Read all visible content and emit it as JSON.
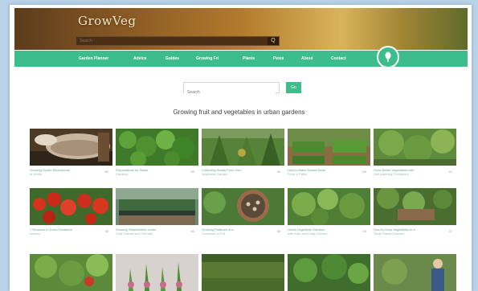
{
  "header": {
    "logo": "GrowVeg",
    "search_placeholder": "Search",
    "search_button": "Q"
  },
  "nav": {
    "items": [
      {
        "label": "Garden Planner"
      },
      {
        "label": "Advice"
      },
      {
        "label": "Guides"
      },
      {
        "label": "Growing Fri"
      },
      {
        "label": "Plants"
      },
      {
        "label": "Pests"
      },
      {
        "label": "About"
      },
      {
        "label": "Contact"
      }
    ]
  },
  "content": {
    "search_placeholder": "Search",
    "go_button": "Go",
    "title": "Growing fruit and vegetables in urban gardens"
  },
  "tiles": [
    {
      "caption": "Growing Oyster Mushrooms",
      "caption2": "at Home",
      "stat": "62"
    },
    {
      "caption": "Preparations for Salad",
      "caption2": "Gardens",
      "stat": "52"
    },
    {
      "caption": "Collecting Seeds From Your",
      "caption2": "Vegetable Garden",
      "stat": "40"
    },
    {
      "caption": "How to Make Raised Beds",
      "caption2": "From a Pallet",
      "stat": "69"
    },
    {
      "caption": "Grow Better Vegetables with",
      "caption2": "Self-watering Containers",
      "stat": "41"
    },
    {
      "caption": "7 Reasons to Grow Tomatoes",
      "caption2": "Indoors",
      "stat": "35"
    },
    {
      "caption": "Growing Strawberries Under",
      "caption2": "Cold Frames and Tunnels",
      "stat": "43"
    },
    {
      "caption": "Growing Potatoes in a",
      "caption2": "Container or Pot",
      "stat": "38"
    },
    {
      "caption": "Urban Vegetable Gardens",
      "caption2": "with Kale and Leafy Greens",
      "stat": "44"
    },
    {
      "caption": "How to Grow Vegetables in a",
      "caption2": "Small Raised Garden",
      "stat": "37"
    },
    {
      "caption": "",
      "caption2": "",
      "stat": ""
    },
    {
      "caption": "",
      "caption2": "",
      "stat": ""
    },
    {
      "caption": "",
      "caption2": "",
      "stat": ""
    },
    {
      "caption": "",
      "caption2": "",
      "stat": ""
    },
    {
      "caption": "",
      "caption2": "",
      "stat": ""
    }
  ],
  "colors": {
    "accent": "#3dbd8c",
    "banner": "#b27a2c",
    "page_bg": "#b9d3ea"
  }
}
